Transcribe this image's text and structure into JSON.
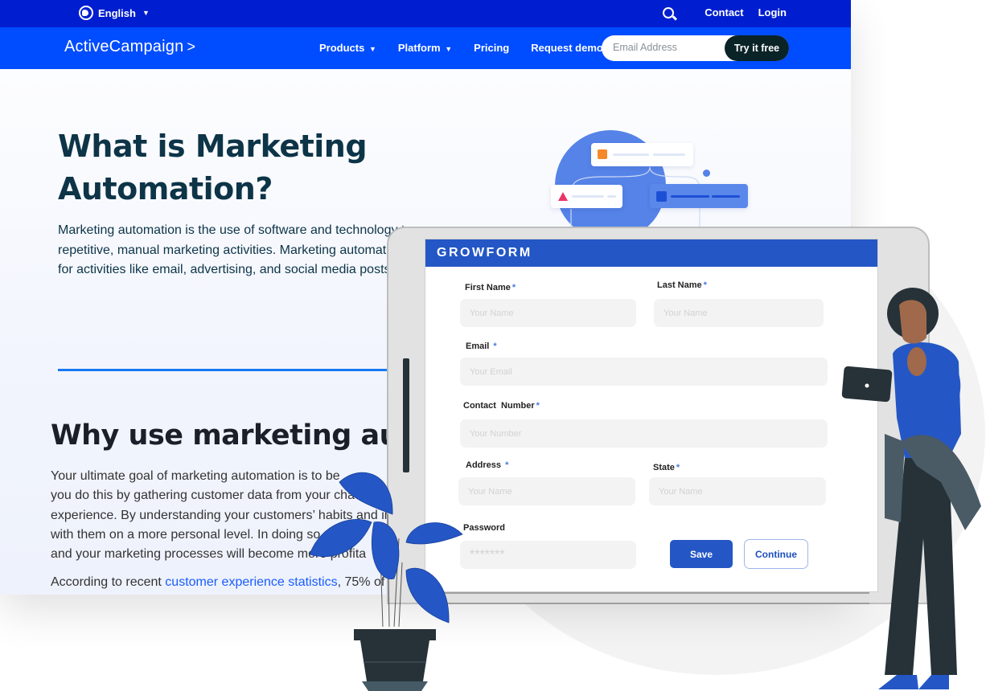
{
  "topbar": {
    "language": "English",
    "contact": "Contact",
    "login": "Login",
    "icons": {
      "language": "globe-icon",
      "search": "search-icon"
    }
  },
  "navbar": {
    "logo": "ActiveCampaign",
    "logo_mark": ">",
    "items": [
      {
        "label": "Products",
        "has_dropdown": true
      },
      {
        "label": "Platform",
        "has_dropdown": true
      },
      {
        "label": "Pricing",
        "has_dropdown": false
      },
      {
        "label": "Request demo",
        "has_dropdown": false
      }
    ],
    "email_placeholder": "Email Address",
    "cta_label": "Try it free"
  },
  "article": {
    "title": "What is Marketing Automation?",
    "intro": "Marketing automation is the use of software and technology t… repetitive, manual marketing activities. Marketing automatic… for activities like email, advertising, and social media posts.",
    "intro_lines": [
      "Marketing automation is the use of software and technology t",
      "repetitive, manual marketing activities. Marketing automatio",
      "for activities like email, advertising, and social media posts."
    ],
    "section_title": "Why use marketing au",
    "body_lines": [
      "Your ultimate goal of marketing automation is to be",
      "you do this by gathering customer data from your cha",
      "experience. By understanding your customers’ habits and in",
      "with them on a more personal level. In doing so",
      "and your marketing processes will become more profita"
    ],
    "stat_prefix": "According to recent ",
    "stat_link": "customer experience statistics",
    "stat_suffix": ", 75% of c"
  },
  "growform": {
    "title": "GROWFORM",
    "fields": {
      "first_name": {
        "label": "First Name",
        "required_mark": "*",
        "placeholder": "Your Name",
        "value": ""
      },
      "last_name": {
        "label": "Last Name",
        "required_mark": "*",
        "placeholder": "Your Name",
        "value": ""
      },
      "email": {
        "label": "Email",
        "required_mark": "*",
        "placeholder": "Your Email",
        "value": ""
      },
      "contact_number": {
        "label": "Contact  Number",
        "required_mark": "*",
        "placeholder": "Your Number",
        "value": ""
      },
      "address": {
        "label": "Address",
        "required_mark": "*",
        "placeholder": "Your Name",
        "value": ""
      },
      "state": {
        "label": "State",
        "required_mark": "*",
        "placeholder": "Your Name",
        "value": ""
      },
      "password": {
        "label": "Password",
        "placeholder": "*******",
        "value": ""
      }
    },
    "save_label": "Save",
    "continue_label": "Continue"
  },
  "colors": {
    "topbar": "#001ecf",
    "navbar": "#004cff",
    "cta": "#0a2327",
    "heading": "#0d3447",
    "form_accent": "#2457c5",
    "link": "#1a5cff",
    "plant": "#2457c5"
  }
}
